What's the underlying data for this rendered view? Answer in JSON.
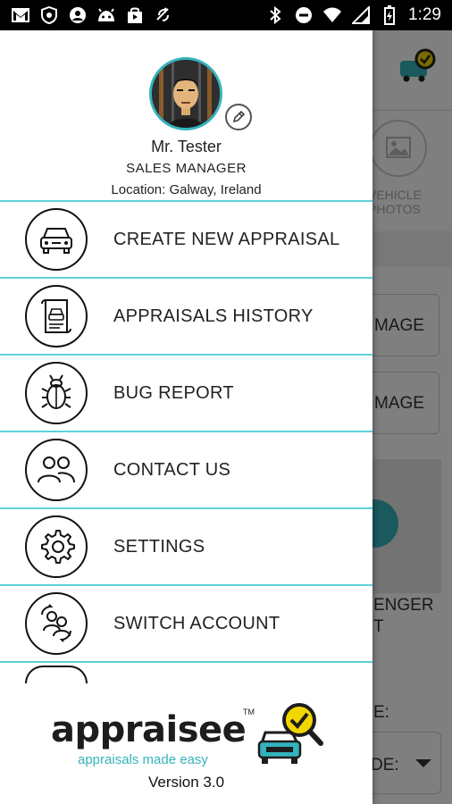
{
  "status_bar": {
    "time": "1:29",
    "left_icons": [
      "gmail-icon",
      "shield-icon",
      "account-icon",
      "android-icon",
      "shopping-bag-icon",
      "no-sync-icon"
    ],
    "right_icons": [
      "bluetooth-icon",
      "do-not-disturb-icon",
      "wifi-icon",
      "signal-icon",
      "battery-charging-icon"
    ]
  },
  "background_screen": {
    "photos_label": "VEHICLE\nPHOTOS",
    "button1_text": "MAGE",
    "button2_text": "MAGE",
    "passenger_text": "ENGER",
    "passenger_text2": "T",
    "field_label": "E:",
    "select_value": "DE:"
  },
  "drawer": {
    "profile": {
      "name": "Mr. Tester",
      "role": "SALES MANAGER",
      "location": "Location: Galway, Ireland"
    },
    "menu": [
      {
        "label": "CREATE NEW APPRAISAL",
        "icon": "car-icon"
      },
      {
        "label": "APPRAISALS HISTORY",
        "icon": "document-car-icon"
      },
      {
        "label": "BUG REPORT",
        "icon": "bug-icon"
      },
      {
        "label": "CONTACT US",
        "icon": "people-icon"
      },
      {
        "label": "SETTINGS",
        "icon": "gear-icon"
      },
      {
        "label": "SWITCH ACCOUNT",
        "icon": "switch-account-icon"
      }
    ],
    "footer": {
      "brand": "appraisee",
      "trademark": "TM",
      "tagline": "appraisals made easy",
      "version": "Version 3.0"
    }
  },
  "colors": {
    "accent": "#34b3bc",
    "divider": "#5fd1d8",
    "logo_yellow": "#f2d600"
  }
}
